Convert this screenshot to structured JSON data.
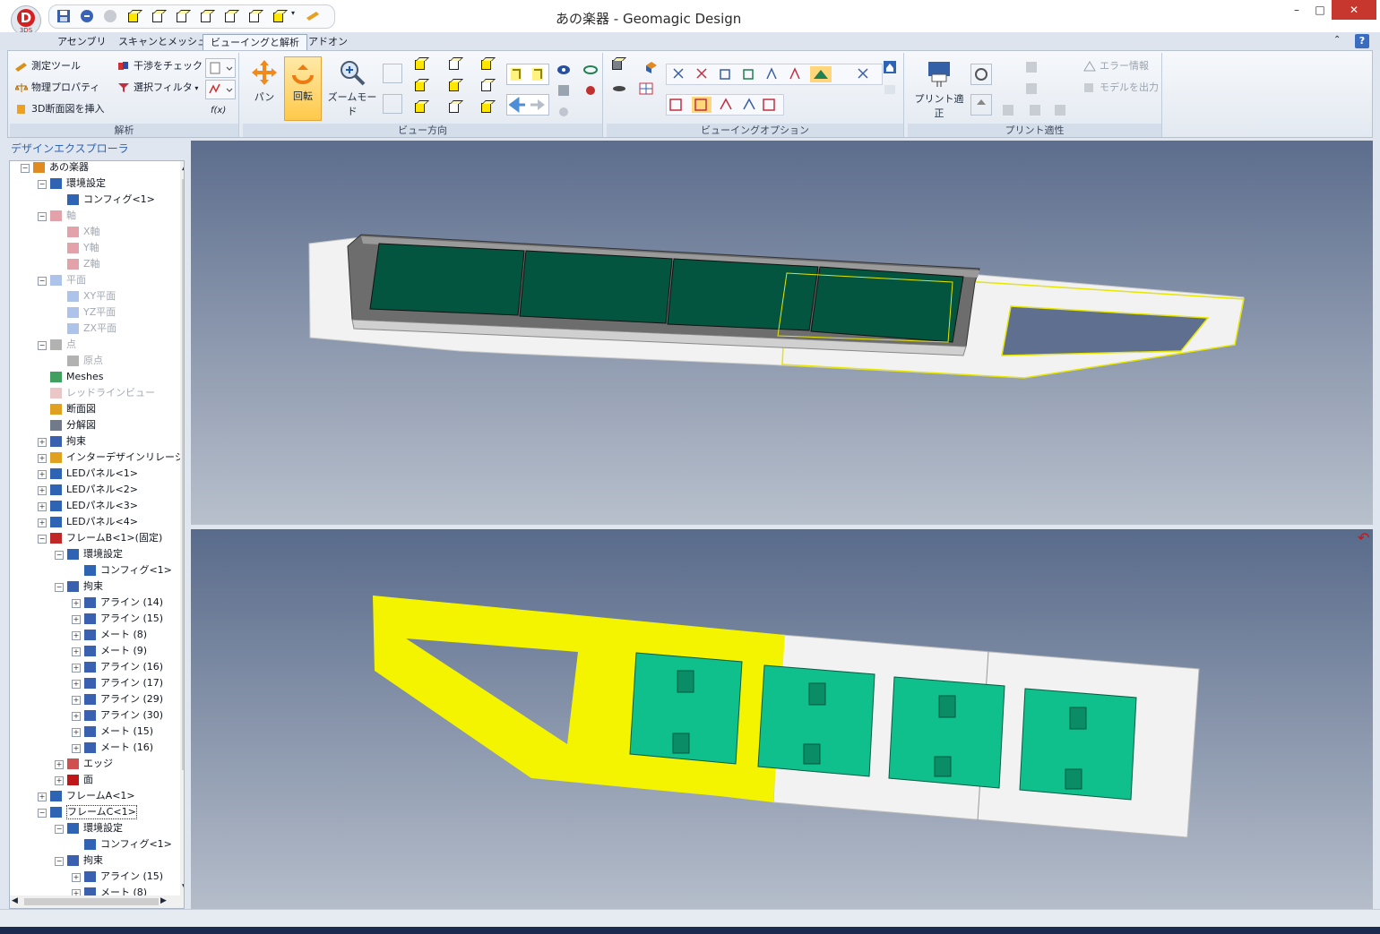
{
  "window": {
    "title": "あの楽器 - Geomagic Design",
    "logo_letter": "D",
    "logo_sub": "3DS",
    "controls": {
      "minimize": "–",
      "maximize": "□",
      "close": "✕"
    }
  },
  "tabs": [
    {
      "label": "アセンブリ",
      "active": false
    },
    {
      "label": "スキャンとメッシュ",
      "active": false
    },
    {
      "label": "ビューイングと解析",
      "active": true
    },
    {
      "label": "アドオン",
      "active": false
    }
  ],
  "ribbon": {
    "analysis": {
      "label": "解析",
      "measure_tool": "測定ツール",
      "physical_props": "物理プロパティ",
      "insert_3d_section": "3D断面図を挿入",
      "interference_check": "干渉をチェック",
      "selection_filter": "選択フィルタ",
      "fx": "f(x)"
    },
    "view_direction": {
      "label": "ビュー方向",
      "pan": "パン",
      "rotate": "回転",
      "zoom_mode": "ズームモード"
    },
    "viewing_options": {
      "label": "ビューイングオプション"
    },
    "print_adapt": {
      "label": "プリント適性",
      "print_fix": "プリント適正",
      "error_info": "エラー情報",
      "export_model": "モデルを出力"
    }
  },
  "explorer": {
    "title": "デザインエクスプローラ",
    "tree": [
      {
        "label": "あの楽器",
        "depth": 0,
        "expander": "−",
        "icon": "assembly-icon",
        "gray": false
      },
      {
        "label": "環境設定",
        "depth": 1,
        "expander": "−",
        "icon": "config-icon",
        "gray": false
      },
      {
        "label": "コンフィグ<1>",
        "depth": 2,
        "expander": "",
        "icon": "config-icon",
        "gray": false
      },
      {
        "label": "軸",
        "depth": 1,
        "expander": "−",
        "icon": "axis-icon",
        "gray": true
      },
      {
        "label": "X軸",
        "depth": 2,
        "expander": "",
        "icon": "axis-icon",
        "gray": true
      },
      {
        "label": "Y軸",
        "depth": 2,
        "expander": "",
        "icon": "axis-icon",
        "gray": true
      },
      {
        "label": "Z軸",
        "depth": 2,
        "expander": "",
        "icon": "axis-icon",
        "gray": true
      },
      {
        "label": "平面",
        "depth": 1,
        "expander": "−",
        "icon": "plane-icon",
        "gray": true
      },
      {
        "label": "XY平面",
        "depth": 2,
        "expander": "",
        "icon": "plane-icon",
        "gray": true
      },
      {
        "label": "YZ平面",
        "depth": 2,
        "expander": "",
        "icon": "plane-icon",
        "gray": true
      },
      {
        "label": "ZX平面",
        "depth": 2,
        "expander": "",
        "icon": "plane-icon",
        "gray": true
      },
      {
        "label": "点",
        "depth": 1,
        "expander": "−",
        "icon": "point-icon",
        "gray": true
      },
      {
        "label": "原点",
        "depth": 2,
        "expander": "",
        "icon": "point-icon",
        "gray": true
      },
      {
        "label": "Meshes",
        "depth": 1,
        "expander": "",
        "icon": "mesh-icon",
        "gray": false
      },
      {
        "label": "レッドラインビュー",
        "depth": 1,
        "expander": "",
        "icon": "redline-icon",
        "gray": true
      },
      {
        "label": "断面図",
        "depth": 1,
        "expander": "",
        "icon": "section-icon",
        "gray": false
      },
      {
        "label": "分解図",
        "depth": 1,
        "expander": "",
        "icon": "exploded-icon",
        "gray": false
      },
      {
        "label": "拘束",
        "depth": 1,
        "expander": "+",
        "icon": "constraint-icon",
        "gray": false
      },
      {
        "label": "インターデザインリレーショ",
        "depth": 1,
        "expander": "+",
        "icon": "relation-icon",
        "gray": false
      },
      {
        "label": "LEDパネル<1>",
        "depth": 1,
        "expander": "+",
        "icon": "part-icon",
        "gray": false
      },
      {
        "label": "LEDパネル<2>",
        "depth": 1,
        "expander": "+",
        "icon": "part-icon",
        "gray": false
      },
      {
        "label": "LEDパネル<3>",
        "depth": 1,
        "expander": "+",
        "icon": "part-icon",
        "gray": false
      },
      {
        "label": "LEDパネル<4>",
        "depth": 1,
        "expander": "+",
        "icon": "part-icon",
        "gray": false
      },
      {
        "label": "フレームB<1>(固定)",
        "depth": 1,
        "expander": "−",
        "icon": "part-fixed-icon",
        "gray": false
      },
      {
        "label": "環境設定",
        "depth": 2,
        "expander": "−",
        "icon": "config-icon",
        "gray": false
      },
      {
        "label": "コンフィグ<1>",
        "depth": 3,
        "expander": "",
        "icon": "config-icon",
        "gray": false
      },
      {
        "label": "拘束",
        "depth": 2,
        "expander": "−",
        "icon": "constraint-icon",
        "gray": false
      },
      {
        "label": "アライン (14)",
        "depth": 3,
        "expander": "+",
        "icon": "constraint-icon",
        "gray": false
      },
      {
        "label": "アライン (15)",
        "depth": 3,
        "expander": "+",
        "icon": "constraint-icon",
        "gray": false
      },
      {
        "label": "メート (8)",
        "depth": 3,
        "expander": "+",
        "icon": "constraint-icon",
        "gray": false
      },
      {
        "label": "メート (9)",
        "depth": 3,
        "expander": "+",
        "icon": "constraint-icon",
        "gray": false
      },
      {
        "label": "アライン (16)",
        "depth": 3,
        "expander": "+",
        "icon": "constraint-icon",
        "gray": false
      },
      {
        "label": "アライン (17)",
        "depth": 3,
        "expander": "+",
        "icon": "constraint-icon",
        "gray": false
      },
      {
        "label": "アライン (29)",
        "depth": 3,
        "expander": "+",
        "icon": "constraint-icon",
        "gray": false
      },
      {
        "label": "アライン (30)",
        "depth": 3,
        "expander": "+",
        "icon": "constraint-icon",
        "gray": false
      },
      {
        "label": "メート (15)",
        "depth": 3,
        "expander": "+",
        "icon": "constraint-icon",
        "gray": false
      },
      {
        "label": "メート (16)",
        "depth": 3,
        "expander": "+",
        "icon": "constraint-icon",
        "gray": false
      },
      {
        "label": "エッジ",
        "depth": 2,
        "expander": "+",
        "icon": "edge-icon",
        "gray": false
      },
      {
        "label": "面",
        "depth": 2,
        "expander": "+",
        "icon": "face-icon",
        "gray": false
      },
      {
        "label": "フレームA<1>",
        "depth": 1,
        "expander": "+",
        "icon": "part-icon",
        "gray": false
      },
      {
        "label": "フレームC<1>",
        "depth": 1,
        "expander": "−",
        "icon": "part-icon",
        "gray": false,
        "selected": true
      },
      {
        "label": "環境設定",
        "depth": 2,
        "expander": "−",
        "icon": "config-icon",
        "gray": false
      },
      {
        "label": "コンフィグ<1>",
        "depth": 3,
        "expander": "",
        "icon": "config-icon",
        "gray": false
      },
      {
        "label": "拘束",
        "depth": 2,
        "expander": "−",
        "icon": "constraint-icon",
        "gray": false
      },
      {
        "label": "アライン (15)",
        "depth": 3,
        "expander": "+",
        "icon": "constraint-icon",
        "gray": false
      },
      {
        "label": "メート (8)",
        "depth": 3,
        "expander": "+",
        "icon": "constraint-icon",
        "gray": false
      }
    ]
  },
  "colors": {
    "led_dark": "#03553f",
    "led_light": "#10c08c",
    "frame_yellow": "#f4f400",
    "frame_white": "#f2f2f2",
    "accent_blue": "#2f63b4",
    "close_red": "#c7372e"
  }
}
